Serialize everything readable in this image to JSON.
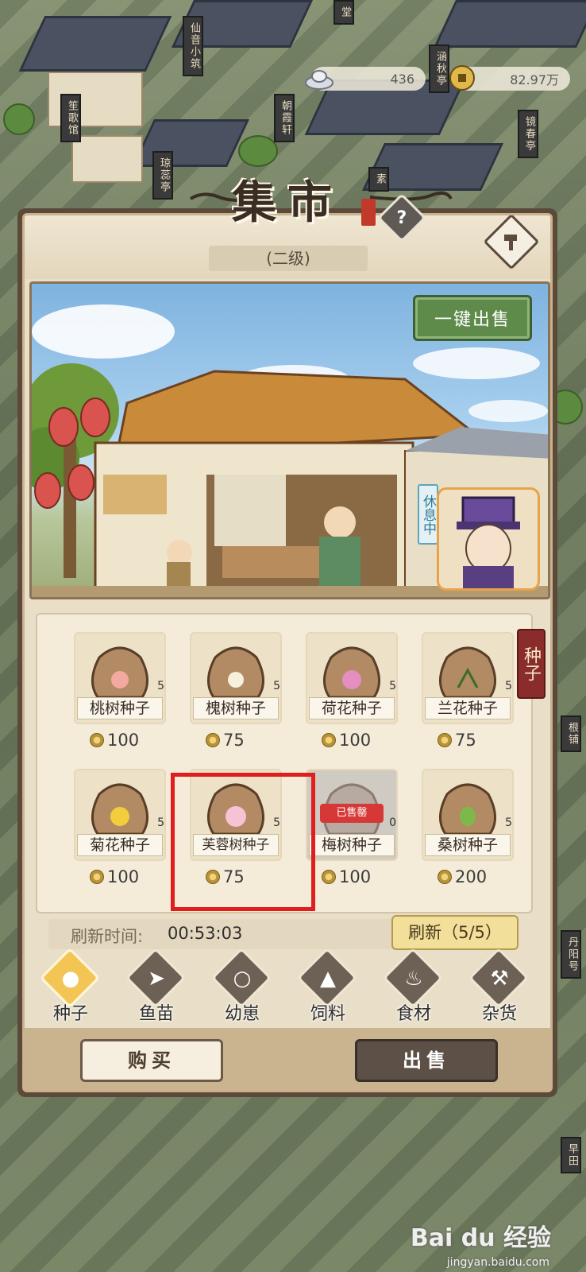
{
  "currency": {
    "silver": "436",
    "copper": "82.97万"
  },
  "town_signs": [
    "笙歌馆",
    "仙音小筑",
    "朝霞轩",
    "涵秋亭",
    "镜春亭",
    "琼蕊亭",
    "素",
    "堂",
    "根铺",
    "丹阳号",
    "早田"
  ],
  "panel": {
    "title": "集市",
    "level": "(二级)",
    "help_symbol": "?"
  },
  "scene": {
    "sell_all_label": "一键出售",
    "resting_label": "休息中"
  },
  "category_tag": "种子",
  "items": [
    {
      "name": "桃树种子",
      "qty": "5",
      "price": "100",
      "sold": false
    },
    {
      "name": "槐树种子",
      "qty": "5",
      "price": "75",
      "sold": false
    },
    {
      "name": "荷花种子",
      "qty": "5",
      "price": "100",
      "sold": false
    },
    {
      "name": "兰花种子",
      "qty": "5",
      "price": "75",
      "sold": false
    },
    {
      "name": "菊花种子",
      "qty": "5",
      "price": "100",
      "sold": false
    },
    {
      "name": "芙蓉树种子",
      "qty": "5",
      "price": "75",
      "sold": false
    },
    {
      "name": "梅树种子",
      "qty": "0",
      "price": "100",
      "sold": true,
      "sold_label": "已售罄"
    },
    {
      "name": "桑树种子",
      "qty": "5",
      "price": "200",
      "sold": false
    }
  ],
  "refresh": {
    "label": "刷新时间:",
    "time": "00:53:03",
    "button": "刷新（5/5）"
  },
  "tabs": [
    {
      "label": "种子",
      "active": true,
      "icon": "seed-bag-icon"
    },
    {
      "label": "鱼苗",
      "active": false,
      "icon": "fish-icon"
    },
    {
      "label": "幼崽",
      "active": false,
      "icon": "pig-icon"
    },
    {
      "label": "饲料",
      "active": false,
      "icon": "feed-sack-icon"
    },
    {
      "label": "食材",
      "active": false,
      "icon": "teapot-icon"
    },
    {
      "label": "杂货",
      "active": false,
      "icon": "hammer-icon"
    }
  ],
  "buttons": {
    "buy": "购买",
    "sell": "出售"
  },
  "watermark": {
    "main": "Bai du 经验",
    "sub": "jingyan.baidu.com"
  },
  "colors": {
    "highlight": "#e01e1e",
    "sell_all_green": "#5e8a4a",
    "category_red": "#8a2c2c"
  }
}
